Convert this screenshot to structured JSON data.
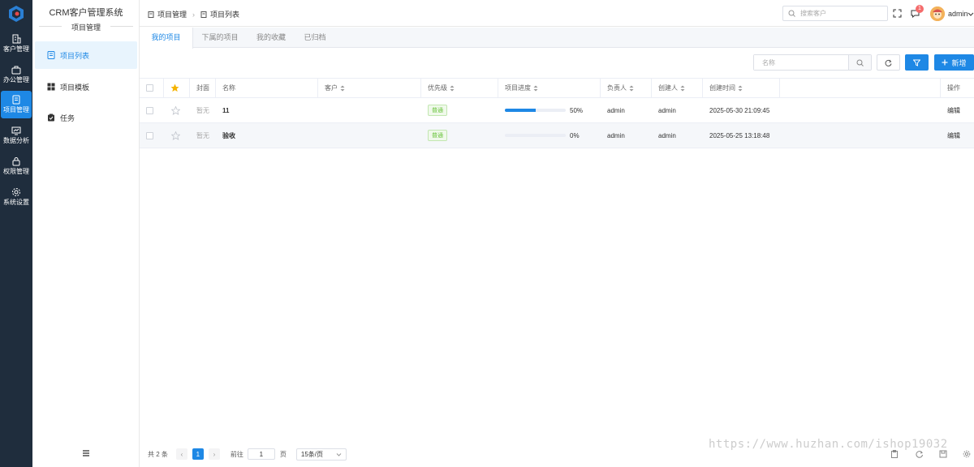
{
  "app": {
    "title": "CRM客户管理系统",
    "section": "项目管理"
  },
  "rail": [
    {
      "label": "客户管理",
      "icon": "building-icon",
      "active": false
    },
    {
      "label": "办公管理",
      "icon": "briefcase-icon",
      "active": false
    },
    {
      "label": "项目管理",
      "icon": "document-icon",
      "active": true
    },
    {
      "label": "数据分析",
      "icon": "chart-icon",
      "active": false
    },
    {
      "label": "权限管理",
      "icon": "lock-icon",
      "active": false
    },
    {
      "label": "系统设置",
      "icon": "gear-icon",
      "active": false
    }
  ],
  "sidebar": {
    "items": [
      {
        "label": "项目列表",
        "icon": "list-icon",
        "active": true
      },
      {
        "label": "项目模板",
        "icon": "grid-icon",
        "active": false
      },
      {
        "label": "任务",
        "icon": "clipboard-icon",
        "active": false
      }
    ]
  },
  "breadcrumb": [
    "项目管理",
    "项目列表"
  ],
  "header": {
    "search_placeholder": "搜索客户",
    "notification_count": "1",
    "username": "admin"
  },
  "tabs": [
    "我的项目",
    "下属的项目",
    "我的收藏",
    "已归档"
  ],
  "toolbar": {
    "search_placeholder": "名称",
    "add_label": "新增"
  },
  "table": {
    "columns": [
      "封面",
      "名称",
      "客户",
      "优先级",
      "项目进度",
      "负责人",
      "创建人",
      "创建时间",
      "操作"
    ],
    "rows": [
      {
        "cover": "暂无",
        "name": "11",
        "customer": "",
        "priority": "普通",
        "progress": 0.5,
        "progress_label": "50%",
        "owner": "admin",
        "creator": "admin",
        "created": "2025-05-30 21:09:45",
        "action": "编辑"
      },
      {
        "cover": "暂无",
        "name": "验收",
        "customer": "",
        "priority": "普通",
        "progress": 0,
        "progress_label": "0%",
        "owner": "admin",
        "creator": "admin",
        "created": "2025-05-25 13:18:48",
        "action": "编辑"
      }
    ]
  },
  "pager": {
    "total": "共 2 条",
    "page": "1",
    "goto_label": "前往",
    "goto_value": "1",
    "page_unit": "页",
    "page_size": "15条/页"
  },
  "watermark": "https://www.huzhan.com/ishop19032",
  "colors": {
    "primary": "#1e88e5",
    "rail": "#1f2d3d",
    "success": "#67c23a",
    "danger": "#f56c6c"
  }
}
